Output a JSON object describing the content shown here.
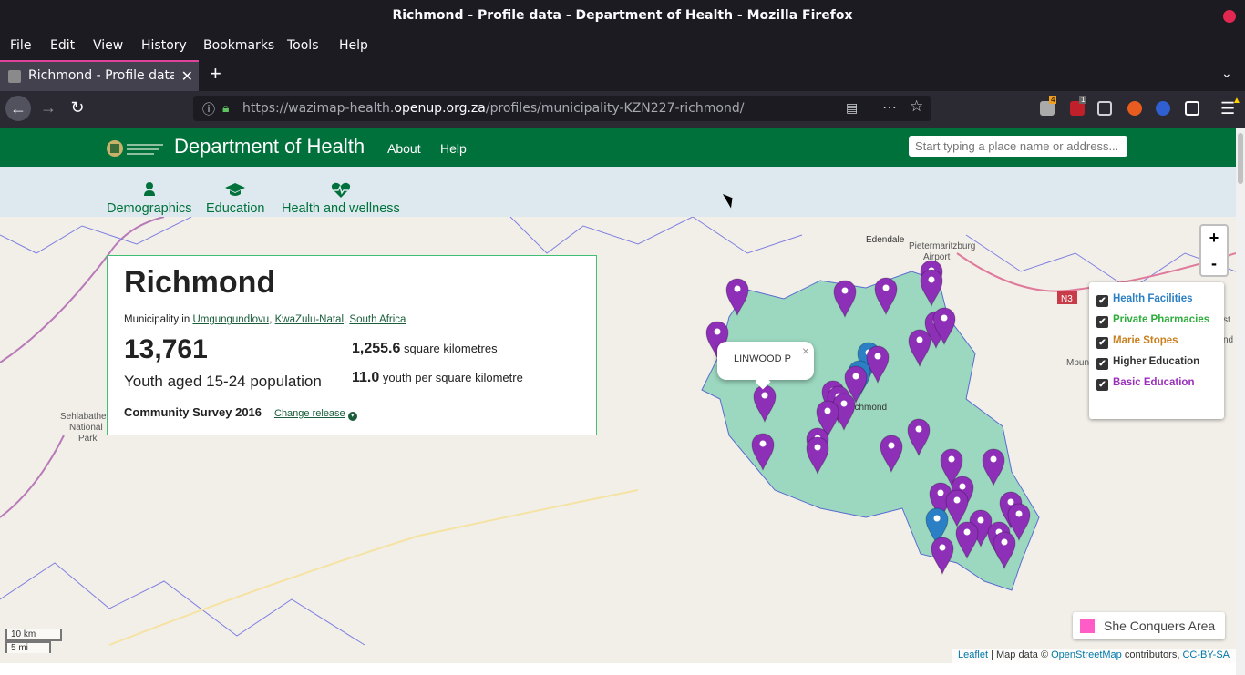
{
  "window": {
    "title": "Richmond - Profile data - Department of Health - Mozilla Firefox"
  },
  "menu": [
    "File",
    "Edit",
    "View",
    "History",
    "Bookmarks",
    "Tools",
    "Help"
  ],
  "tab": {
    "title": "Richmond - Profile data - Department of Health",
    "new_tab": "+"
  },
  "url": {
    "prefix": "https://wazimap-health.",
    "domain": "openup.org.za",
    "path": "/profiles/municipality-KZN227-richmond/"
  },
  "toolbar_badges": {
    "addon1": "4",
    "addon2": "1"
  },
  "site": {
    "title": "Department of Health",
    "nav": [
      "About",
      "Help"
    ],
    "search_placeholder": "Start typing a place name or address..."
  },
  "subnav": [
    {
      "label": "Demographics",
      "icon": "person-icon"
    },
    {
      "label": "Education",
      "icon": "graduation-cap-icon"
    },
    {
      "label": "Health and wellness",
      "icon": "heartbeat-icon"
    }
  ],
  "profile": {
    "name": "Richmond",
    "type_prefix": "Municipality in",
    "parents": [
      "Umgungundlovu",
      "KwaZulu-Natal",
      "South Africa"
    ],
    "population_value": "13,761",
    "population_label": "Youth aged 15-24 population",
    "area_value": "1,255.6",
    "area_label": "square kilometres",
    "density_value": "11.0",
    "density_label": "youth per square kilometre",
    "release": "Community Survey 2016",
    "change_release": "Change release"
  },
  "map": {
    "zoom_in": "+",
    "zoom_out": "-",
    "popup_text": "LINWOOD P",
    "popup_close": "×",
    "layers": [
      {
        "label": "Health Facilities",
        "color": "#2a7fc5",
        "checked": true
      },
      {
        "label": "Private Pharmacies",
        "color": "#2fad3c",
        "checked": true
      },
      {
        "label": "Marie Stopes",
        "color": "#c9801f",
        "checked": true
      },
      {
        "label": "Higher Education",
        "color": "#333333",
        "checked": true
      },
      {
        "label": "Basic Education",
        "color": "#9b2fbd",
        "checked": true
      }
    ],
    "legend_area": {
      "label": "She Conquers Area",
      "color": "#ff5cc7"
    },
    "scale": [
      "10 km",
      "5 mi"
    ],
    "place_labels": [
      "Edendale",
      "Pietermaritzburg",
      "Airport",
      "Richmond",
      "Sehlabathebe",
      "National",
      "Park",
      "N3",
      "Mpun",
      "st",
      "nd"
    ],
    "attribution": {
      "leaflet": "Leaflet",
      "mapdata": "| Map data ©",
      "osm": "OpenStreetMap",
      "contrib": "contributors,",
      "license": "CC-BY-SA"
    }
  },
  "colors": {
    "brand": "#00713b",
    "subnav_bg": "#dde9ee",
    "marker_purple": "#8e2fb8",
    "marker_blue": "#2a7fc5",
    "area_fill": "#7fd0b2"
  }
}
